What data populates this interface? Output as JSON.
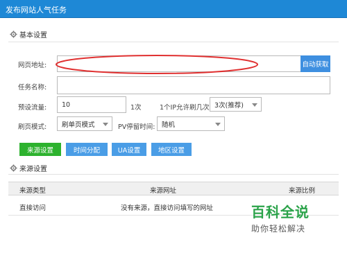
{
  "window": {
    "title": "发布网站人气任务"
  },
  "basic_settings": {
    "title": "基本设置"
  },
  "form": {
    "url_label": "网页地址:",
    "url_value": "",
    "auto_fetch_label": "自动获取",
    "task_name_label": "任务名称:",
    "task_name_value": "",
    "traffic_label": "预设流量:",
    "traffic_value": "10",
    "traffic_unit": "1次",
    "ip_label": "1个IP允许刷几次:",
    "ip_value": "3次(推荐)",
    "mode_label": "刷页模式:",
    "mode_value": "刷单页模式",
    "pv_label": "PV停留时间:",
    "pv_value": "随机"
  },
  "tabs": [
    {
      "label": "来源设置",
      "active": true
    },
    {
      "label": "时间分配",
      "active": false
    },
    {
      "label": "UA设置",
      "active": false
    },
    {
      "label": "地区设置",
      "active": false
    }
  ],
  "source_settings": {
    "title": "来源设置"
  },
  "table": {
    "headers": [
      "来源类型",
      "来源网址",
      "来源比例"
    ],
    "rows": [
      {
        "type": "直接访问",
        "url": "没有来源，直接访问填写的网址",
        "ratio": ""
      }
    ]
  },
  "watermark": {
    "brand": "百科全说",
    "subtitle": "助你轻松解决"
  },
  "colors": {
    "title_bar": "#1e88d6",
    "button_blue": "#3e8fe0",
    "tab_active": "#2db22e",
    "annotation_red": "#e03030",
    "watermark_green": "#2ba34a"
  }
}
